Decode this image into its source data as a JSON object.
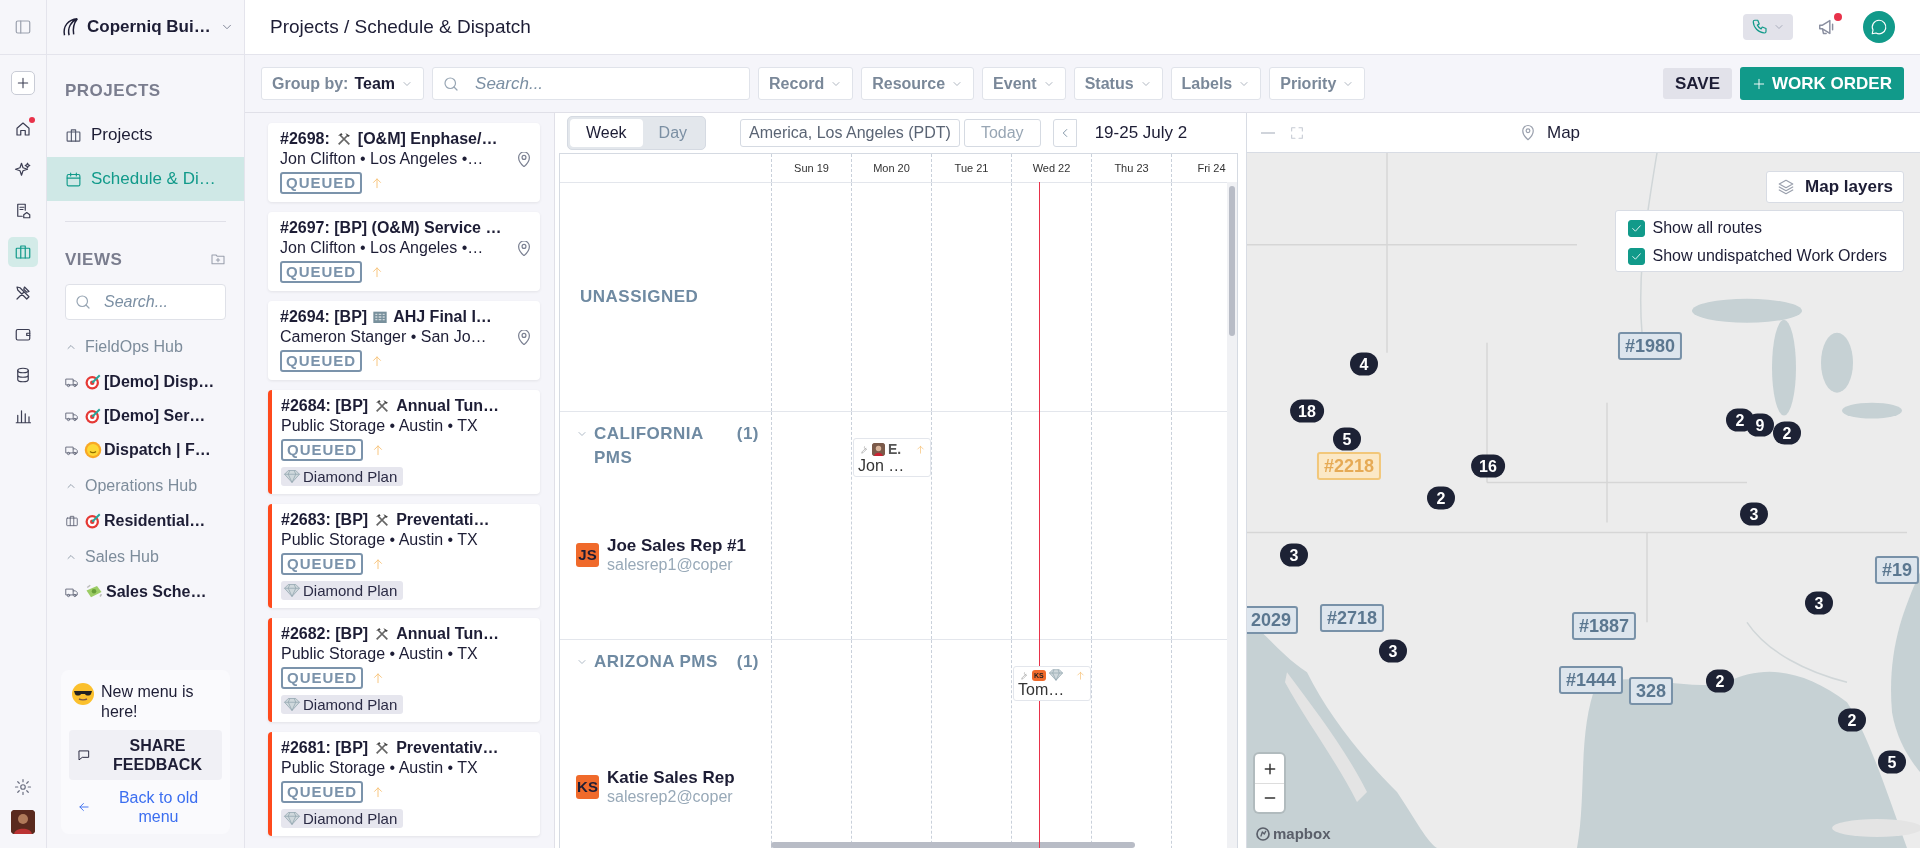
{
  "rail": {
    "items": [
      {
        "kind": "plus",
        "selected": false,
        "dot": false
      },
      {
        "kind": "home",
        "selected": false,
        "dot": true
      },
      {
        "kind": "sparkles",
        "selected": false,
        "dot": false
      },
      {
        "kind": "document",
        "selected": false,
        "dot": false
      },
      {
        "kind": "briefcase",
        "selected": true,
        "dot": false
      },
      {
        "kind": "tools",
        "selected": false,
        "dot": false
      },
      {
        "kind": "wallet",
        "selected": false,
        "dot": false
      },
      {
        "kind": "database",
        "selected": false,
        "dot": false
      },
      {
        "kind": "chart",
        "selected": false,
        "dot": false
      }
    ]
  },
  "sidebar": {
    "workspace": "Coperniq Bui…",
    "projects_label": "PROJECTS",
    "nav": [
      {
        "label": "Projects",
        "kind": "briefcase",
        "selected": false
      },
      {
        "label": "Schedule & Di…",
        "kind": "calendar",
        "selected": true
      }
    ],
    "views_label": "VIEWS",
    "search": {
      "placeholder": "Search..."
    },
    "groups": [
      {
        "label": "FieldOps Hub",
        "expanded": true,
        "items": [
          {
            "label": "[Demo] Disp…",
            "kind": "target"
          },
          {
            "label": "[Demo] Ser…",
            "kind": "target"
          },
          {
            "label": "Dispatch | F…",
            "kind": "sun"
          }
        ]
      },
      {
        "label": "Operations Hub",
        "expanded": true,
        "items": [
          {
            "label": "Residential…",
            "kind": "project"
          }
        ]
      },
      {
        "label": "Sales Hub",
        "expanded": true,
        "items": [
          {
            "label": "Sales Sche…",
            "kind": "money"
          }
        ]
      }
    ],
    "promo": {
      "text": "New menu is here!",
      "button": "SHARE FEEDBACK",
      "link": "Back to old menu"
    }
  },
  "header": {
    "breadcrumb": "Projects / Schedule & Dispatch",
    "notification_dot": true
  },
  "toolbar": {
    "group_by": {
      "label": "Group by:",
      "value": "Team"
    },
    "search": {
      "placeholder": "Search..."
    },
    "filters": [
      "Record",
      "Resource",
      "Event",
      "Status",
      "Labels",
      "Priority"
    ],
    "save": "SAVE",
    "create": "WORK ORDER"
  },
  "work_orders": [
    {
      "title": "#2698:",
      "kind": "tools",
      "title_rest": "[O&M] Enphase/…",
      "subtitle": "Jon Clifton • Los Angeles •…",
      "located": true,
      "status": "QUEUED",
      "marked": false
    },
    {
      "title": "#2697: [BP] (O&M) Service …",
      "kind": "plain",
      "subtitle": "Jon Clifton • Los Angeles •…",
      "located": true,
      "status": "QUEUED",
      "marked": false
    },
    {
      "title": "#2694: [BP]",
      "kind": "building",
      "title_rest": "AHJ Final I…",
      "subtitle": "Cameron Stanger • San Jo…",
      "located": true,
      "status": "QUEUED",
      "marked": false
    },
    {
      "title": "#2684: [BP]",
      "kind": "tools",
      "title_rest": "Annual Tun…",
      "subtitle": "Public Storage • Austin • TX",
      "located": false,
      "status": "QUEUED",
      "marked": true,
      "plan": "Diamond Plan"
    },
    {
      "title": "#2683: [BP]",
      "kind": "tools",
      "title_rest": "Preventati…",
      "subtitle": "Public Storage • Austin • TX",
      "located": false,
      "status": "QUEUED",
      "marked": true,
      "plan": "Diamond Plan"
    },
    {
      "title": "#2682: [BP]",
      "kind": "tools",
      "title_rest": "Annual Tun…",
      "subtitle": "Public Storage • Austin • TX",
      "located": false,
      "status": "QUEUED",
      "marked": true,
      "plan": "Diamond Plan"
    },
    {
      "title": "#2681: [BP]",
      "kind": "tools",
      "title_rest": "Preventativ…",
      "subtitle": "Public Storage • Austin • TX",
      "located": false,
      "status": "QUEUED",
      "marked": true,
      "plan": "Diamond Plan"
    }
  ],
  "schedule": {
    "views": [
      {
        "label": "Week",
        "selected": true
      },
      {
        "label": "Day",
        "selected": false
      }
    ],
    "timezone": "America, Los Angeles (PDT)",
    "today": "Today",
    "range": "19-25 July 2",
    "days": [
      "Sun 19",
      "Mon 20",
      "Tue 21",
      "Wed 22",
      "Thu 23",
      "Fri 24"
    ],
    "groups": [
      {
        "kind": "unassigned",
        "label": "UNASSIGNED"
      },
      {
        "kind": "team",
        "label": "CALIFORNIA PMS",
        "count": "(1)",
        "expanded": true,
        "members": [
          {
            "initials": "JS",
            "name": "Joe Sales Rep #1",
            "email": "salesrep1@coper"
          }
        ],
        "events": [
          {
            "label": "E.",
            "plan": false,
            "title": "Jon …"
          }
        ]
      },
      {
        "kind": "team",
        "label": "ARIZONA PMS",
        "count": "(1)",
        "expanded": true,
        "members": [
          {
            "initials": "KS",
            "name": "Katie Sales Rep",
            "email": "salesrep2@coper"
          }
        ],
        "events": [
          {
            "kind": "initials",
            "initials": "KS",
            "plan": true,
            "title": "Tom…"
          }
        ]
      }
    ]
  },
  "map": {
    "title": "Map",
    "layers_button": "Map layers",
    "options": [
      {
        "label": "Show all routes",
        "checked": true
      },
      {
        "label": "Show undispatched Work Orders",
        "checked": true
      }
    ],
    "markers": [
      {
        "kind": "cluster",
        "label": "4"
      },
      {
        "kind": "order",
        "label": "#1980",
        "selected": false
      },
      {
        "kind": "cluster",
        "label": "18"
      },
      {
        "kind": "cluster",
        "label": "2"
      },
      {
        "kind": "cluster",
        "label": "9"
      },
      {
        "kind": "cluster",
        "label": "2"
      },
      {
        "kind": "cluster",
        "label": "5"
      },
      {
        "kind": "order",
        "label": "#2218",
        "selected": true
      },
      {
        "kind": "cluster",
        "label": "16"
      },
      {
        "kind": "cluster",
        "label": "2"
      },
      {
        "kind": "cluster",
        "label": "3"
      },
      {
        "kind": "cluster",
        "label": "3"
      },
      {
        "kind": "order",
        "label": "#19",
        "selected": false
      },
      {
        "kind": "cluster",
        "label": "3"
      },
      {
        "kind": "order",
        "label": "2029",
        "selected": false
      },
      {
        "kind": "order",
        "label": "#2718",
        "selected": false
      },
      {
        "kind": "order",
        "label": "#1887",
        "selected": false
      },
      {
        "kind": "cluster",
        "label": "3"
      },
      {
        "kind": "order",
        "label": "328",
        "selected": false
      },
      {
        "kind": "order",
        "label": "#1444",
        "selected": false
      },
      {
        "kind": "cluster",
        "label": "2"
      },
      {
        "kind": "cluster",
        "label": "2"
      },
      {
        "kind": "cluster",
        "label": "5"
      }
    ],
    "attribution": "mapbox"
  }
}
